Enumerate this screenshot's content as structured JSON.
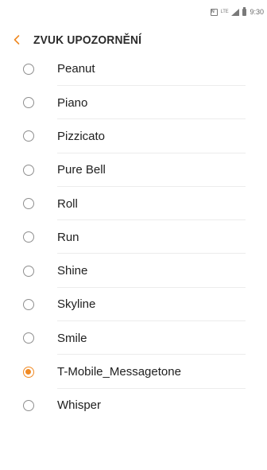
{
  "status_bar": {
    "nfc_label": "N",
    "network_label": "LTE",
    "icons": [
      "nfc-icon",
      "lte-icon",
      "signal-icon",
      "battery-icon"
    ],
    "time": "9:30"
  },
  "header": {
    "back_icon": "chevron-left-icon",
    "title": "ZVUK UPOZORNĚNÍ"
  },
  "colors": {
    "accent": "#f08a24",
    "radio_unchecked": "#8e8e8e",
    "text": "#202020",
    "divider": "#ececec"
  },
  "sounds": [
    {
      "label": "Peanut",
      "selected": false
    },
    {
      "label": "Piano",
      "selected": false
    },
    {
      "label": "Pizzicato",
      "selected": false
    },
    {
      "label": "Pure Bell",
      "selected": false
    },
    {
      "label": "Roll",
      "selected": false
    },
    {
      "label": "Run",
      "selected": false
    },
    {
      "label": "Shine",
      "selected": false
    },
    {
      "label": "Skyline",
      "selected": false
    },
    {
      "label": "Smile",
      "selected": false
    },
    {
      "label": "T-Mobile_Messagetone",
      "selected": true
    },
    {
      "label": "Whisper",
      "selected": false
    }
  ]
}
